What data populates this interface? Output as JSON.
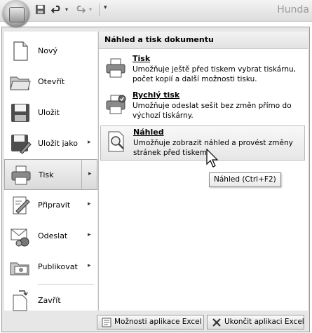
{
  "window": {
    "title": "Hunda"
  },
  "panel": {
    "heading": "Náhled a tisk dokumentu"
  },
  "menu": {
    "items": [
      {
        "label": "Nový"
      },
      {
        "label": "Otevřít"
      },
      {
        "label": "Uložit"
      },
      {
        "label": "Uložit jako",
        "arrow": "▸"
      },
      {
        "label": "Tisk",
        "arrow": "▸"
      },
      {
        "label": "Připravit",
        "arrow": "▸"
      },
      {
        "label": "Odeslat",
        "arrow": "▸"
      },
      {
        "label": "Publikovat",
        "arrow": "▸"
      },
      {
        "label": "Zavřít"
      }
    ]
  },
  "print_options": [
    {
      "title": "Tisk",
      "desc": "Umožňuje ještě před tiskem vybrat tiskárnu, počet kopií a další možnosti tisku."
    },
    {
      "title": "Rychlý tisk",
      "desc": "Umožňuje odeslat sešit bez změn přímo do výchozí tiskárny."
    },
    {
      "title": "Náhled",
      "desc": "Umožňuje zobrazit náhled a provést změny stránek před tiskem."
    }
  ],
  "tooltip": {
    "text": "Náhled (Ctrl+F2)"
  },
  "footer": {
    "options_label": "Možnosti aplikace Excel",
    "exit_label": "Ukončit aplikaci Excel"
  },
  "qat": {
    "dropdown_glyph": "▾",
    "customize_glyph": "▾"
  }
}
